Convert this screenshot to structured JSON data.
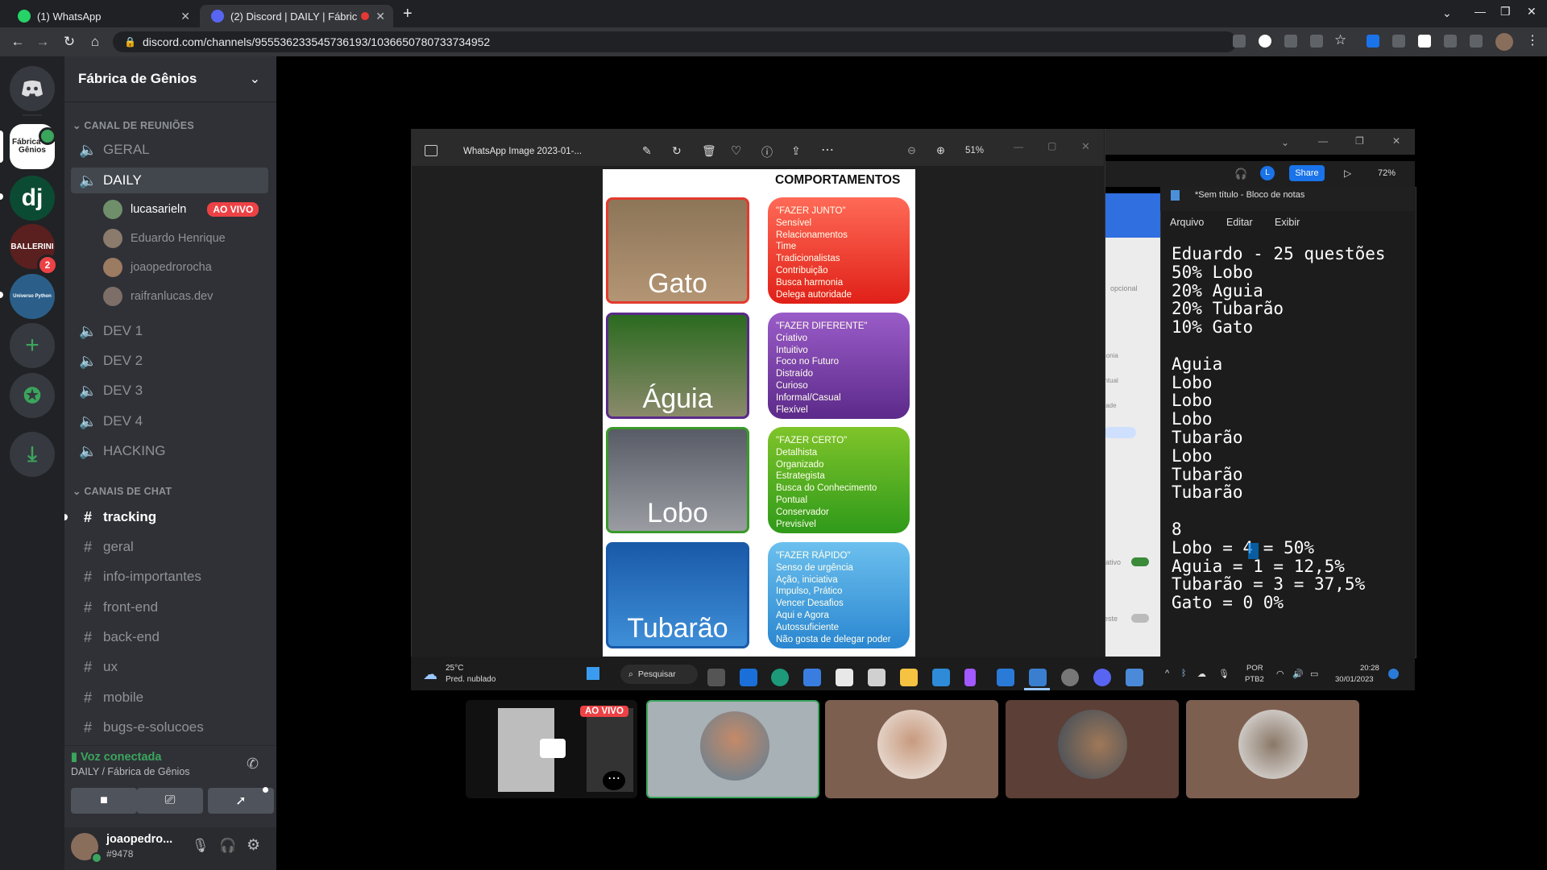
{
  "browser": {
    "tabs": [
      {
        "label": "(1) WhatsApp",
        "icon": "whatsapp-icon"
      },
      {
        "label": "(2) Discord | DAILY | Fábric",
        "icon": "discord-icon"
      }
    ],
    "url": "discord.com/channels/955536233545736193/1036650780733734952"
  },
  "server": {
    "name": "Fábrica de Gênios",
    "icon_labels": [
      "Fábrica de Gênios",
      "dj",
      "BALLERINI",
      "Universo Python"
    ],
    "ballerini_badge": "2"
  },
  "categories": {
    "voice": "CANAL DE REUNIÕES",
    "chat": "CANAIS DE CHAT"
  },
  "voice_channels": [
    {
      "label": "GERAL"
    },
    {
      "label": "DAILY"
    },
    {
      "label": "DEV 1"
    },
    {
      "label": "DEV 2"
    },
    {
      "label": "DEV 3"
    },
    {
      "label": "DEV 4"
    },
    {
      "label": "HACKING"
    }
  ],
  "voice_users": [
    {
      "name": "lucasarieln",
      "badge": "AO VIVO"
    },
    {
      "name": "Eduardo Henrique"
    },
    {
      "name": "joaopedrorocha"
    },
    {
      "name": "raifranlucas.dev"
    }
  ],
  "text_channels": [
    {
      "label": "tracking"
    },
    {
      "label": "geral"
    },
    {
      "label": "info-importantes"
    },
    {
      "label": "front-end"
    },
    {
      "label": "back-end"
    },
    {
      "label": "ux"
    },
    {
      "label": "mobile"
    },
    {
      "label": "bugs-e-solucoes"
    }
  ],
  "voice_status": {
    "title": "Voz conectada",
    "subtitle": "DAILY / Fábrica de Gênios"
  },
  "user": {
    "name": "joaopedro...",
    "tag": "#9478"
  },
  "photos_window": {
    "title": "WhatsApp Image 2023-01-...",
    "zoom": "51%",
    "heading": "COMPORTAMENTOS",
    "animals": [
      "Gato",
      "Águia",
      "Lobo",
      "Tubarão"
    ],
    "traits": [
      {
        "title": "\"FAZER JUNTO\"",
        "items": [
          "Sensível",
          "Relacionamentos",
          "Time",
          "Tradicionalistas",
          "Contribuição",
          "Busca harmonia",
          "Delega autoridade"
        ]
      },
      {
        "title": "\"FAZER DIFERENTE\"",
        "items": [
          "Criativo",
          "Intuitivo",
          "Foco no Futuro",
          "Distraído",
          "Curioso",
          "Informal/Casual",
          "Flexível"
        ]
      },
      {
        "title": "\"FAZER CERTO\"",
        "items": [
          "Detalhista",
          "Organizado",
          "Estrategista",
          "Busca do Conhecimento",
          "Pontual",
          "Conservador",
          "Previsível"
        ]
      },
      {
        "title": "\"FAZER RÁPIDO\"",
        "items": [
          "Senso de urgência",
          "Ação, iniciativa",
          "Impulso, Prático",
          "Vencer Desafios",
          "Aqui e Agora",
          "Autossuficiente",
          "Não gosta de delegar poder"
        ]
      }
    ]
  },
  "share_toolbar": {
    "share_label": "Share",
    "zoom": "72%",
    "avatar_letter": "L"
  },
  "notepad": {
    "title": "*Sem título - Bloco de notas",
    "menu": [
      "Arquivo",
      "Editar",
      "Exibir"
    ],
    "lines": [
      "Eduardo - 25 questões",
      "50% Lobo",
      "20% Aguia",
      "20% Tubarão",
      "10% Gato",
      "",
      "Aguia",
      "Lobo",
      "Lobo",
      "Lobo",
      "Tubarão",
      "Lobo",
      "Tubarão",
      "Tubarão",
      "",
      "8",
      "Lobo = 4 = 50%",
      "Aguia = 1 = 12,5%",
      "Tubarão = 3 = 37,5%",
      "Gato = 0 0%"
    ]
  },
  "background_hints": [
    "opcional",
    "monia",
    "ontual",
    "idade",
    "ativo",
    "este"
  ],
  "taskbar": {
    "weather_temp": "25°C",
    "weather_desc": "Pred. nublado",
    "search": "Pesquisar",
    "lang": "POR",
    "lang2": "PTB2",
    "time": "20:28",
    "date": "30/01/2023"
  },
  "stream_badge": "AO VIVO"
}
